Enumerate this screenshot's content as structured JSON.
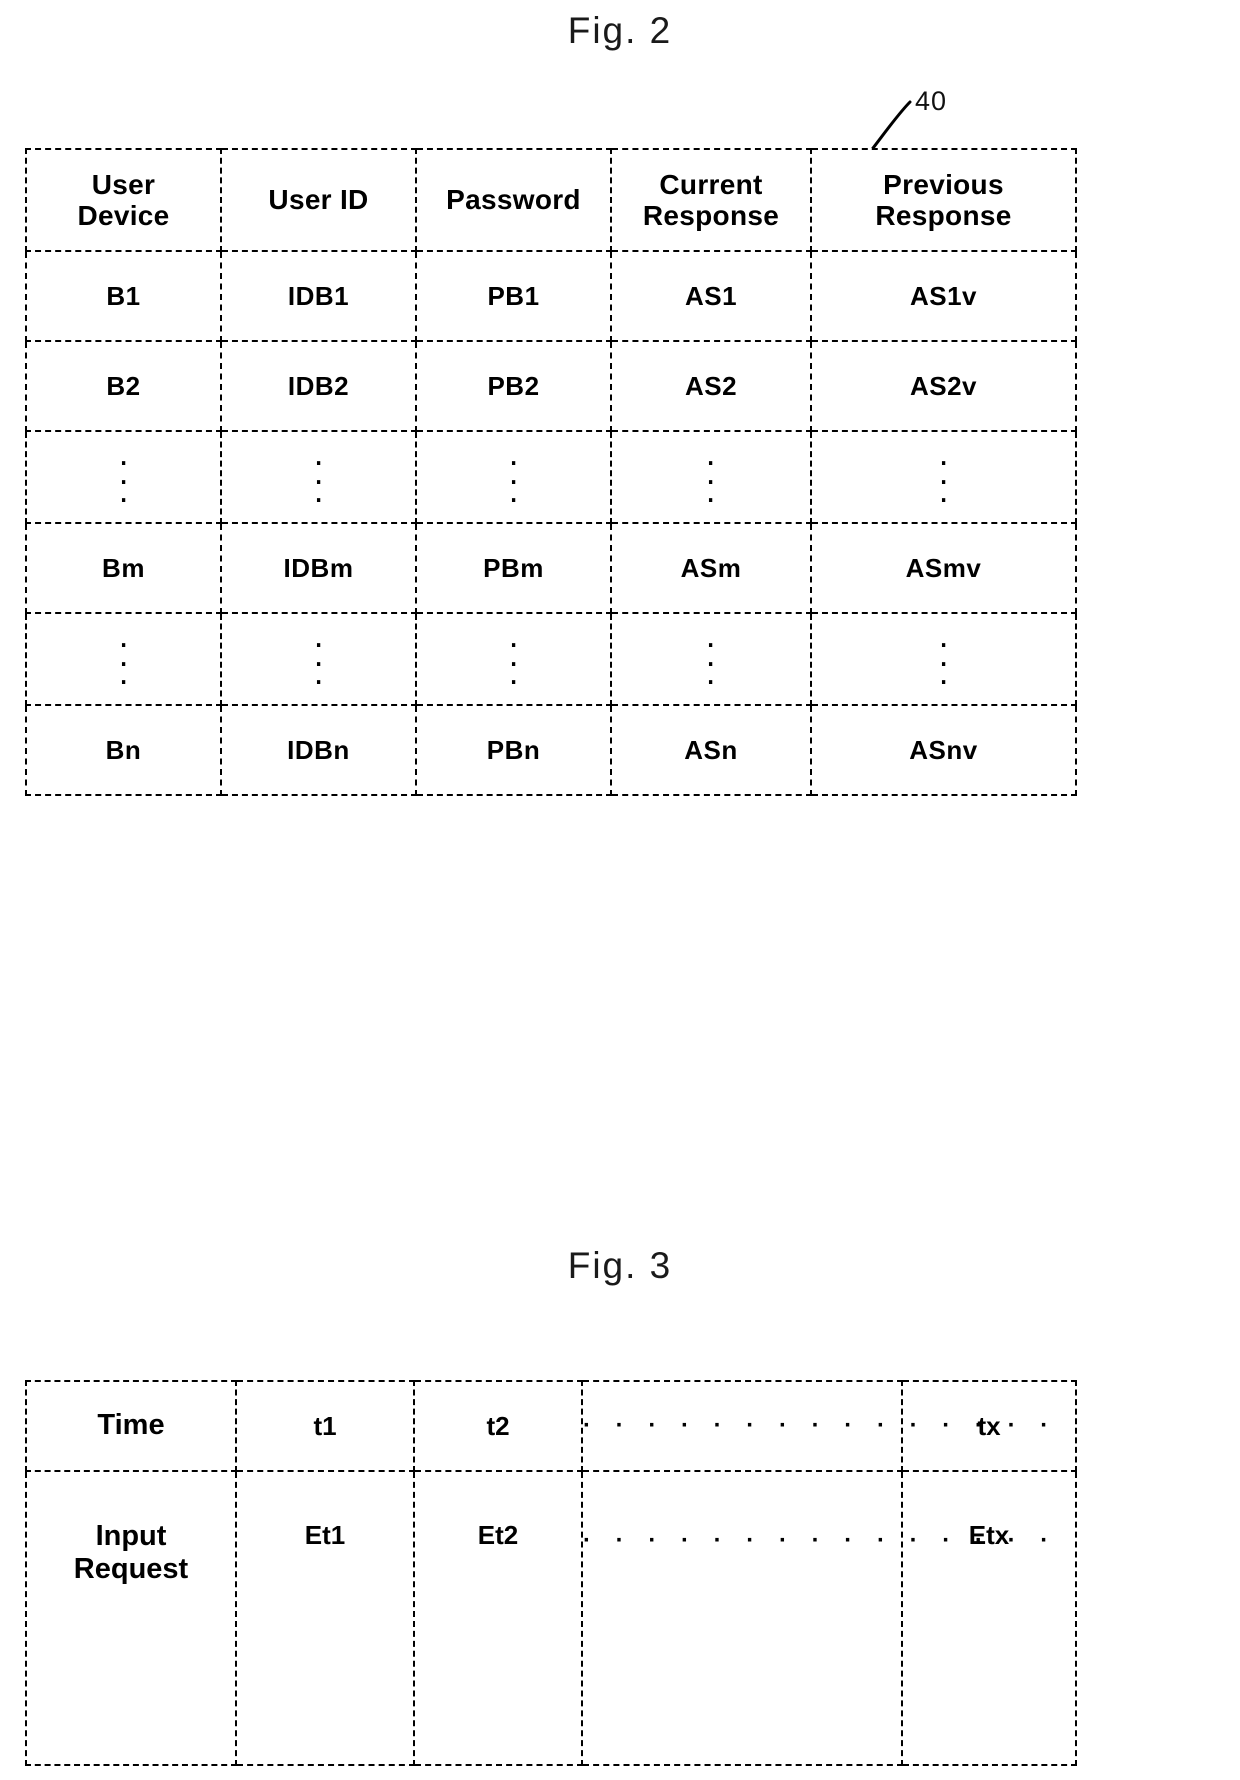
{
  "figures": {
    "fig2": {
      "title": "Fig. 2",
      "reference_numeral": "40",
      "table": {
        "headers": [
          "User\nDevice",
          "User ID",
          "Password",
          "Current\nResponse",
          "Previous\nResponse"
        ],
        "headers_flat": [
          "User Device",
          "User ID",
          "Password",
          "Current Response",
          "Previous Response"
        ],
        "rows": [
          {
            "type": "data",
            "cells": [
              "B1",
              "IDB1",
              "PB1",
              "AS1",
              "AS1v"
            ]
          },
          {
            "type": "data",
            "cells": [
              "B2",
              "IDB2",
              "PB2",
              "AS2",
              "AS2v"
            ]
          },
          {
            "type": "ellipsis",
            "cells": [
              "⋮",
              "⋮",
              "⋮",
              "⋮",
              "⋮"
            ]
          },
          {
            "type": "data",
            "cells": [
              "Bm",
              "IDBm",
              "PBm",
              "ASm",
              "ASmv"
            ]
          },
          {
            "type": "ellipsis",
            "cells": [
              "⋮",
              "⋮",
              "⋮",
              "⋮",
              "⋮"
            ]
          },
          {
            "type": "data",
            "cells": [
              "Bn",
              "IDBn",
              "PBn",
              "ASn",
              "ASnv"
            ]
          }
        ]
      }
    },
    "fig3": {
      "title": "Fig. 3",
      "table": {
        "rows": [
          {
            "label": "Time",
            "values": [
              "t1",
              "t2",
              "· · · · · · · · · · · · · · ·",
              "tx"
            ]
          },
          {
            "label": "Input\nRequest",
            "label_line1": "Input",
            "label_line2": "Request",
            "values": [
              "Et1",
              "Et2",
              "· · · · · · · · · · · · · · ·",
              "Etx"
            ]
          }
        ]
      }
    }
  },
  "fig2_header_lines": {
    "c0_l1": "User",
    "c0_l2": "Device",
    "c1": "User ID",
    "c2": "Password",
    "c3_l1": "Current",
    "c3_l2": "Response",
    "c4_l1": "Previous",
    "c4_l2": "Response"
  },
  "fig2_cells": {
    "r1": [
      "B1",
      "IDB1",
      "PB1",
      "AS1",
      "AS1v"
    ],
    "r2": [
      "B2",
      "IDB2",
      "PB2",
      "AS2",
      "AS2v"
    ],
    "rm": [
      "Bm",
      "IDBm",
      "PBm",
      "ASm",
      "ASmv"
    ],
    "rn": [
      "Bn",
      "IDBn",
      "PBn",
      "ASn",
      "ASnv"
    ]
  },
  "fig3_cells": {
    "time_label": "Time",
    "t1": "t1",
    "t2": "t2",
    "tx": "tx",
    "input_l1": "Input",
    "input_l2": "Request",
    "et1": "Et1",
    "et2": "Et2",
    "etx": "Etx",
    "dots": "· · · · · · · · · · · · · · ·"
  },
  "colors": {
    "ink": "#000000",
    "paper": "#ffffff"
  }
}
